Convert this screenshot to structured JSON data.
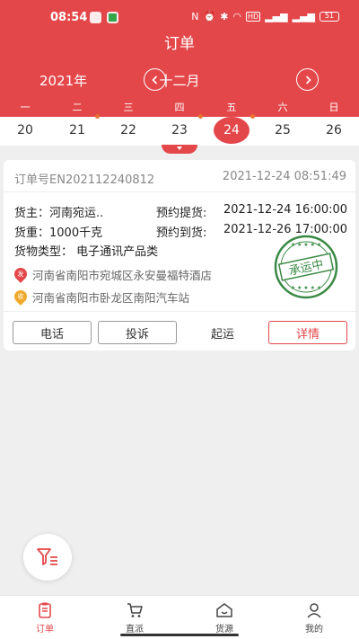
{
  "status_bar": {
    "time": "08:54",
    "battery": "51",
    "network": "HD"
  },
  "nav": {
    "title": "订单"
  },
  "calendar": {
    "year": "2021年",
    "month": "十二月",
    "weekdays": [
      "一",
      "二",
      "三",
      "四",
      "五",
      "六",
      "日"
    ],
    "dates": [
      "20",
      "21",
      "22",
      "23",
      "24",
      "25",
      "26"
    ],
    "selected_date": "24"
  },
  "order": {
    "order_no": "订单号EN202112240812",
    "created_at": "2021-12-24 08:51:49",
    "shipper": "货主：河南宛运..",
    "pickup_label": "预约提货:",
    "pickup_time": "2021-12-24 16:00:00",
    "weight": "货重：1000千克",
    "arrival_label": "预约到货:",
    "arrival_time": "2021-12-26 17:00:00",
    "cargo_type": "货物类型：  电子通讯产品类",
    "from_badge": "发",
    "from_address": "河南省南阳市宛城区永安曼福特酒店",
    "to_badge": "收",
    "to_address": "河南省南阳市卧龙区南阳汽车站",
    "stamp_text": "承运中",
    "colors": {
      "from_pin": "#e4474a",
      "to_pin": "#f0a92b",
      "stamp": "#3a8a45"
    }
  },
  "actions": {
    "phone": "电话",
    "complaint": "投诉",
    "depart": "起运",
    "detail": "详情"
  },
  "tabbar": {
    "items": [
      {
        "label": "订单",
        "icon": "order-icon",
        "active": true
      },
      {
        "label": "直派",
        "icon": "cart-icon",
        "active": false
      },
      {
        "label": "货源",
        "icon": "home-icon",
        "active": false
      },
      {
        "label": "我的",
        "icon": "user-icon",
        "active": false
      }
    ]
  },
  "theme": {
    "primary": "#e4474a",
    "dot": "#e8732f"
  }
}
